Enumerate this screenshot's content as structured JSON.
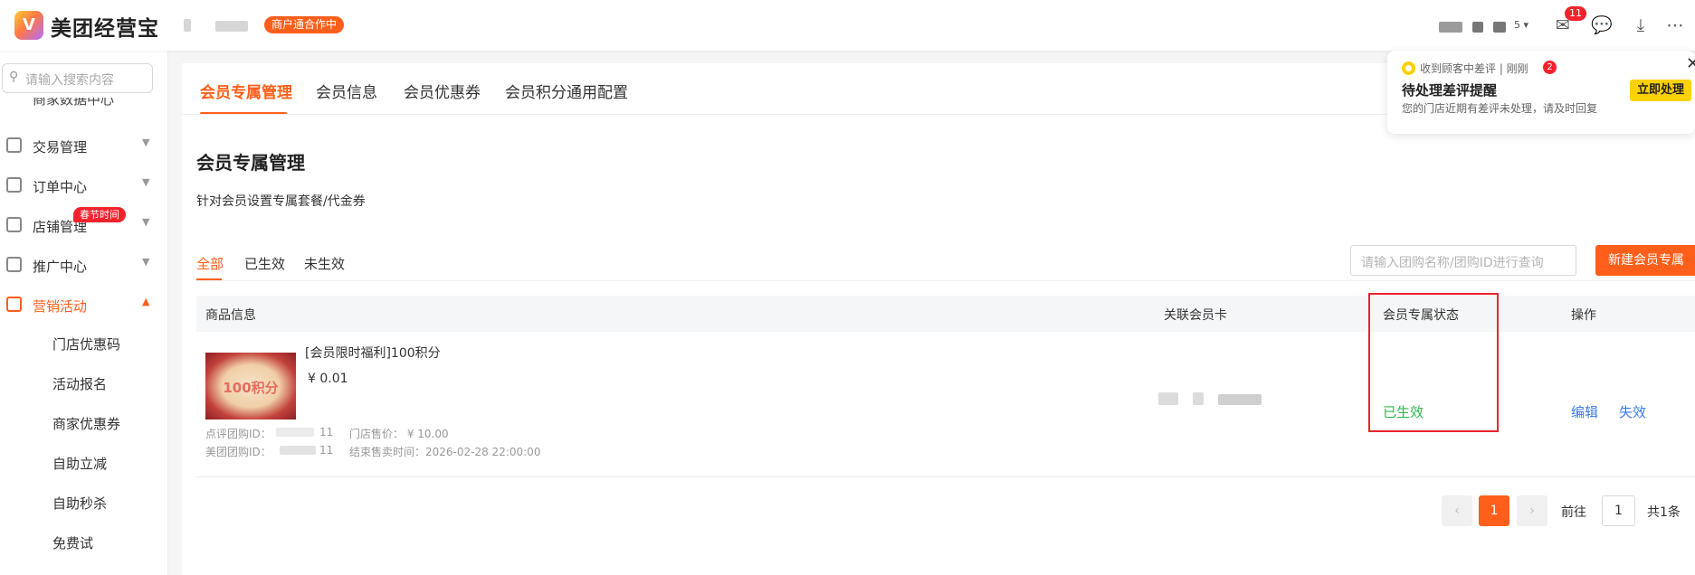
{
  "header": {
    "brand": "美团经营宝",
    "coop_badge": "商户通合作中",
    "message_count": "11"
  },
  "sidebar": {
    "search_placeholder": "请输入搜索内容",
    "items": [
      {
        "label": "交易管理",
        "icon": "transaction-icon"
      },
      {
        "label": "订单中心",
        "icon": "order-icon"
      },
      {
        "label": "店铺管理",
        "icon": "store-icon",
        "tag": "春节时间"
      },
      {
        "label": "推广中心",
        "icon": "megaphone-icon"
      },
      {
        "label": "营销活动",
        "icon": "marketing-icon",
        "active": true
      }
    ],
    "sub_items": [
      "门店优惠码",
      "活动报名",
      "商家优惠券",
      "自助立减",
      "自助秒杀",
      "免费试"
    ]
  },
  "main": {
    "tabs": [
      "会员专属管理",
      "会员信息",
      "会员优惠券",
      "会员积分通用配置"
    ],
    "title": "会员专属管理",
    "description": "针对会员设置专属套餐/代金券",
    "filter_tabs": [
      "全部",
      "已生效",
      "未生效"
    ],
    "query_placeholder": "请输入团购名称/团购ID进行查询",
    "new_button": "新建会员专属",
    "columns": [
      "商品信息",
      "关联会员卡",
      "会员专属状态",
      "操作"
    ],
    "row": {
      "thumb_text": "100积分",
      "title": "[会员限时福利]100积分",
      "price": "¥ 0.01",
      "dp_id_label": "点评团购ID：",
      "dp_id_tail": "11",
      "store_price": "门店售价： ¥ 10.00",
      "mt_id_label": "美团团购ID：",
      "mt_id_tail": "11",
      "end_time": "结束售卖时间：2026-02-28 22:00:00",
      "status": "已生效",
      "actions": [
        "编辑",
        "失效"
      ]
    },
    "pagination": {
      "current": "1",
      "goto_label": "前往",
      "goto_value": "1",
      "total": "共1条"
    }
  },
  "notice": {
    "source": "收到顾客中差评 | 刚刚",
    "count": "2",
    "title": "待处理差评提醒",
    "body": "您的门店近期有差评未处理，请及时回复",
    "button": "立即处理"
  },
  "colors": {
    "accent": "#ff5f1a",
    "success": "#2db84d",
    "link": "#3b7bf0",
    "highlight": "#e8252b"
  }
}
